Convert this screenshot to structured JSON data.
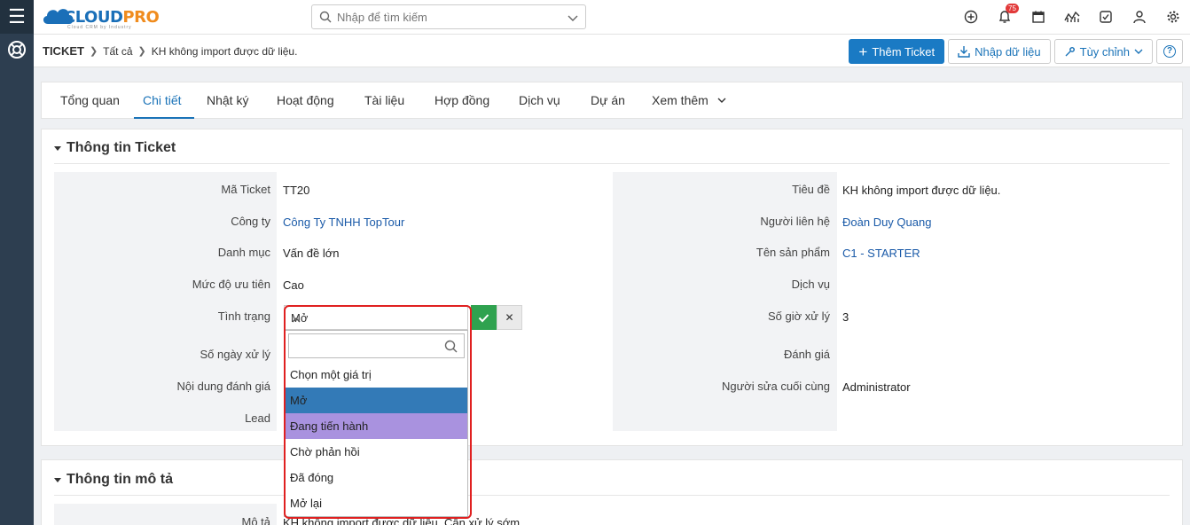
{
  "brand": {
    "name": "CLOUDPRO",
    "name_part1": "CLOUD",
    "name_part2": "PRO",
    "tagline": "Cloud CRM by Industry",
    "blue": "#1a6fb8",
    "orange": "#f08c1e"
  },
  "header": {
    "search_placeholder": "Nhập để tìm kiếm",
    "notification_count": "75",
    "icons": [
      "plus-circle-icon",
      "bell-icon",
      "calendar-icon",
      "chart-icon",
      "checkbox-icon",
      "user-icon",
      "gear-icon"
    ]
  },
  "breadcrumb": {
    "module": "TICKET",
    "level1": "Tất cả",
    "current": "KH không import được dữ liệu."
  },
  "toolbar": {
    "add_label": "Thêm Ticket",
    "import_label": "Nhập dữ liệu",
    "customize_label": "Tùy chỉnh",
    "help_label": "?"
  },
  "tabs": [
    {
      "label": "Tổng quan"
    },
    {
      "label": "Chi tiết",
      "active": true
    },
    {
      "label": "Nhật ký"
    },
    {
      "label": "Hoạt động"
    },
    {
      "label": "Tài liệu"
    },
    {
      "label": "Hợp đồng"
    },
    {
      "label": "Dịch vụ"
    },
    {
      "label": "Dự án"
    },
    {
      "label": "Xem thêm"
    }
  ],
  "ticket_info": {
    "title": "Thông tin Ticket",
    "left": [
      {
        "label": "Mã Ticket",
        "value": "TT20"
      },
      {
        "label": "Công ty",
        "value": "Công Ty TNHH TopTour"
      },
      {
        "label": "Danh mục",
        "value": "Vấn đề lớn"
      },
      {
        "label": "Mức độ ưu tiên",
        "value": "Cao"
      },
      {
        "label": "Tình trạng",
        "value": "Mở"
      },
      {
        "label": "Số ngày xử lý",
        "value": ""
      },
      {
        "label": "Nội dung đánh giá",
        "value": ""
      },
      {
        "label": "Lead",
        "value": ""
      }
    ],
    "right": [
      {
        "label": "Tiêu đề",
        "value": "KH không import được dữ liệu."
      },
      {
        "label": "Người liên hệ",
        "value": "Đoàn Duy Quang"
      },
      {
        "label": "Tên sản phẩm",
        "value": "C1 - STARTER"
      },
      {
        "label": "Dịch vụ",
        "value": ""
      },
      {
        "label": "Số giờ xử lý",
        "value": "3"
      },
      {
        "label": "Đánh giá",
        "value": ""
      },
      {
        "label": "Người sửa cuối cùng",
        "value": "Administrator"
      }
    ]
  },
  "status_dropdown": {
    "current": "Mở",
    "options": [
      "Chọn một giá trị",
      "Mở",
      "Đang tiến hành",
      "Chờ phản hồi",
      "Đã đóng",
      "Mở lại"
    ],
    "selected_index": 1,
    "hover_index": 2,
    "selected_color": "#337ab7",
    "hover_color": "#a992df"
  },
  "description": {
    "title": "Thông tin mô tả",
    "label": "Mô tả",
    "value": "KH không import được dữ liệu. Cần xử lý sớm"
  }
}
